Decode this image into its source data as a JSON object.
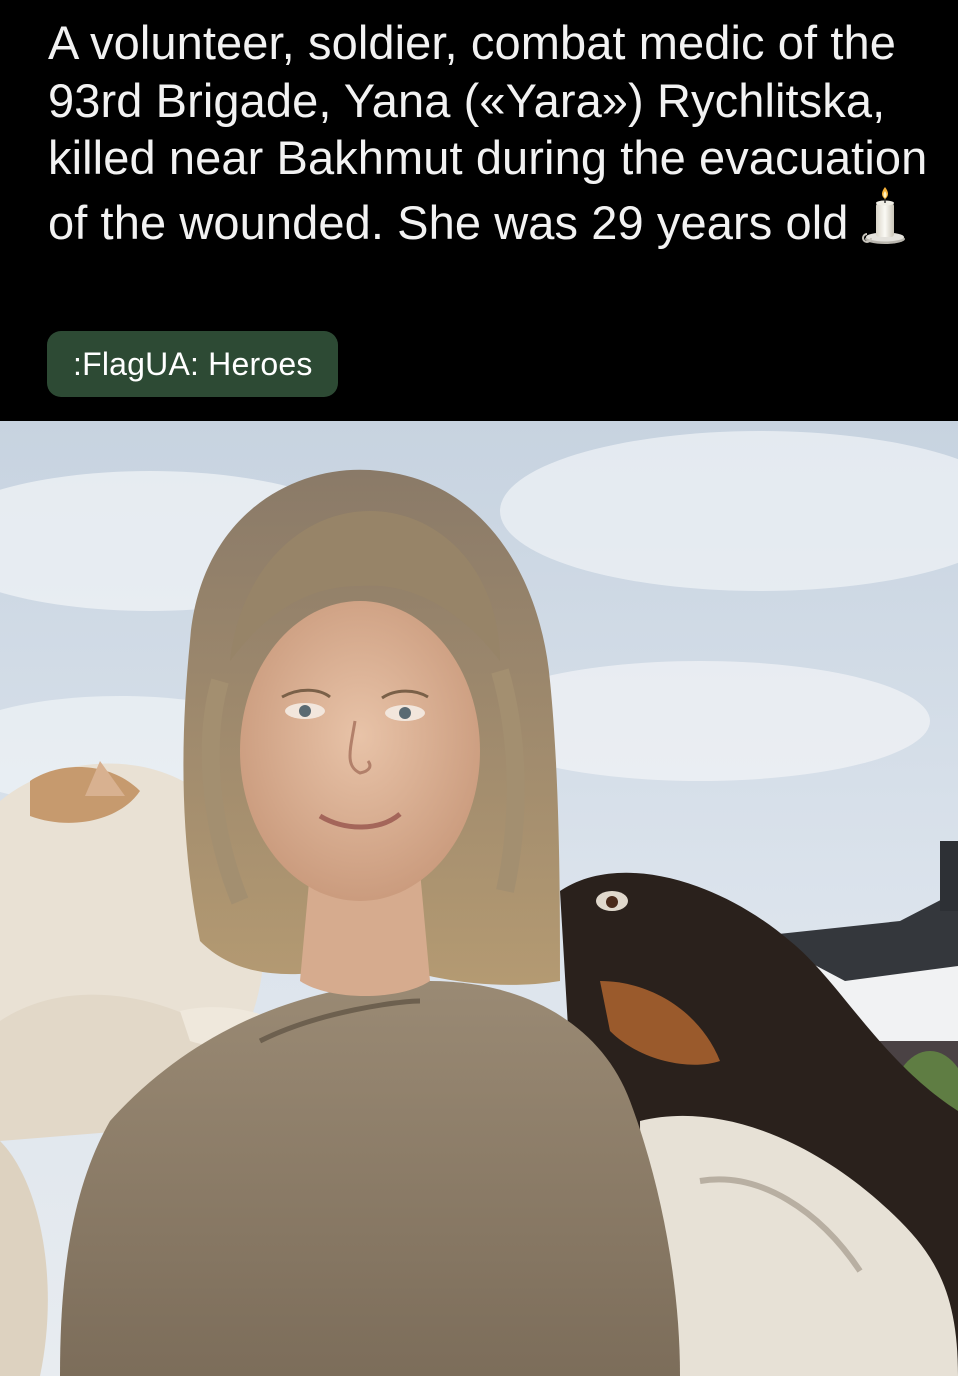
{
  "post": {
    "title": "A volunteer, soldier, combat medic of the 93rd Brigade, Yana («Yara») Rychlitska, killed near Bakhmut during the evacuation of the wounded. She was 29 years old",
    "title_emoji": "candle-icon",
    "flair": {
      "label": ":FlagUA: Heroes",
      "background": "#2d4a34"
    },
    "image": {
      "subject": "photo-woman-with-cat-and-dog"
    }
  },
  "colors": {
    "background": "#000000",
    "text": "#f2f2f2",
    "flair_bg": "#2d4a34"
  }
}
